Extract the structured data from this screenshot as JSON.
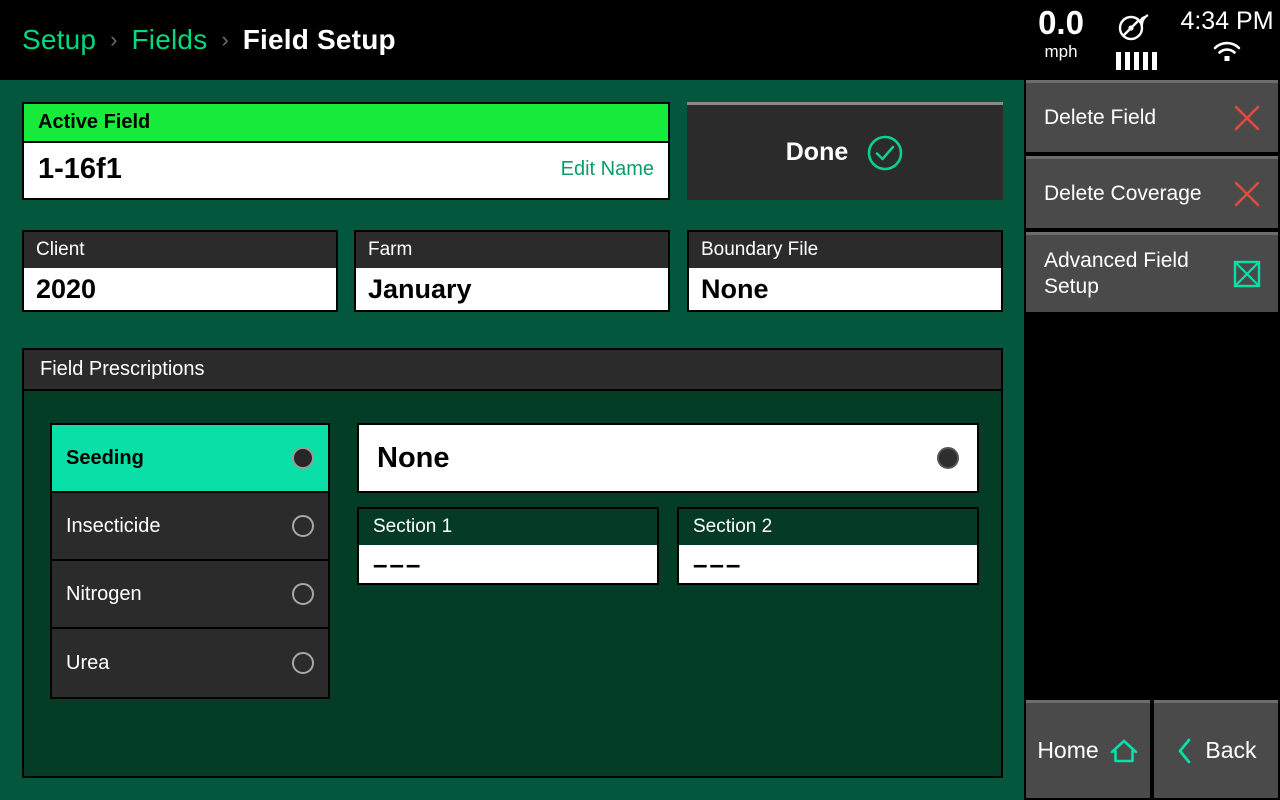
{
  "breadcrumb": {
    "items": [
      {
        "label": "Setup",
        "active": false
      },
      {
        "label": "Fields",
        "active": false
      },
      {
        "label": "Field Setup",
        "active": true
      }
    ],
    "separator": "›"
  },
  "status": {
    "speed_value": "0.0",
    "speed_unit": "mph",
    "gps_icon": "satellite-dish-icon",
    "gps_bars": 5,
    "time": "4:34 PM",
    "wifi_icon": "wifi-icon"
  },
  "active_field": {
    "header": "Active Field",
    "name": "1-16f1",
    "edit_label": "Edit Name",
    "header_color": "#17EC3C"
  },
  "done_button": {
    "label": "Done",
    "icon": "check-circle-icon",
    "accent": "#0ECF93"
  },
  "fields": [
    {
      "header": "Client",
      "value": "2020"
    },
    {
      "header": "Farm",
      "value": "January"
    },
    {
      "header": "Boundary File",
      "value": "None"
    }
  ],
  "prescriptions": {
    "header": "Field Prescriptions",
    "items": [
      {
        "label": "Seeding",
        "selected": true
      },
      {
        "label": "Insecticide",
        "selected": false
      },
      {
        "label": "Nitrogen",
        "selected": false
      },
      {
        "label": "Urea",
        "selected": false
      }
    ],
    "selected_value": "None",
    "sections": [
      {
        "header": "Section 1",
        "value": "–––"
      },
      {
        "header": "Section 2",
        "value": "–––"
      }
    ]
  },
  "sidebar": {
    "buttons": [
      {
        "label": "Delete Field",
        "icon": "close-x-icon",
        "icon_color": "#E04A3F"
      },
      {
        "label": "Delete Coverage",
        "icon": "close-x-icon",
        "icon_color": "#E04A3F"
      },
      {
        "label": "Advanced Field Setup",
        "icon": "field-boundary-icon",
        "icon_color": "#0ADFA8"
      }
    ],
    "nav": [
      {
        "label": "Home",
        "icon": "home-icon"
      },
      {
        "label": "Back",
        "icon": "chevron-left-icon"
      }
    ]
  },
  "theme": {
    "page_bg": "#02573C",
    "panel_bg": "#033D26",
    "accent_green": "#00D97E",
    "accent_teal": "#0ADFA8"
  }
}
